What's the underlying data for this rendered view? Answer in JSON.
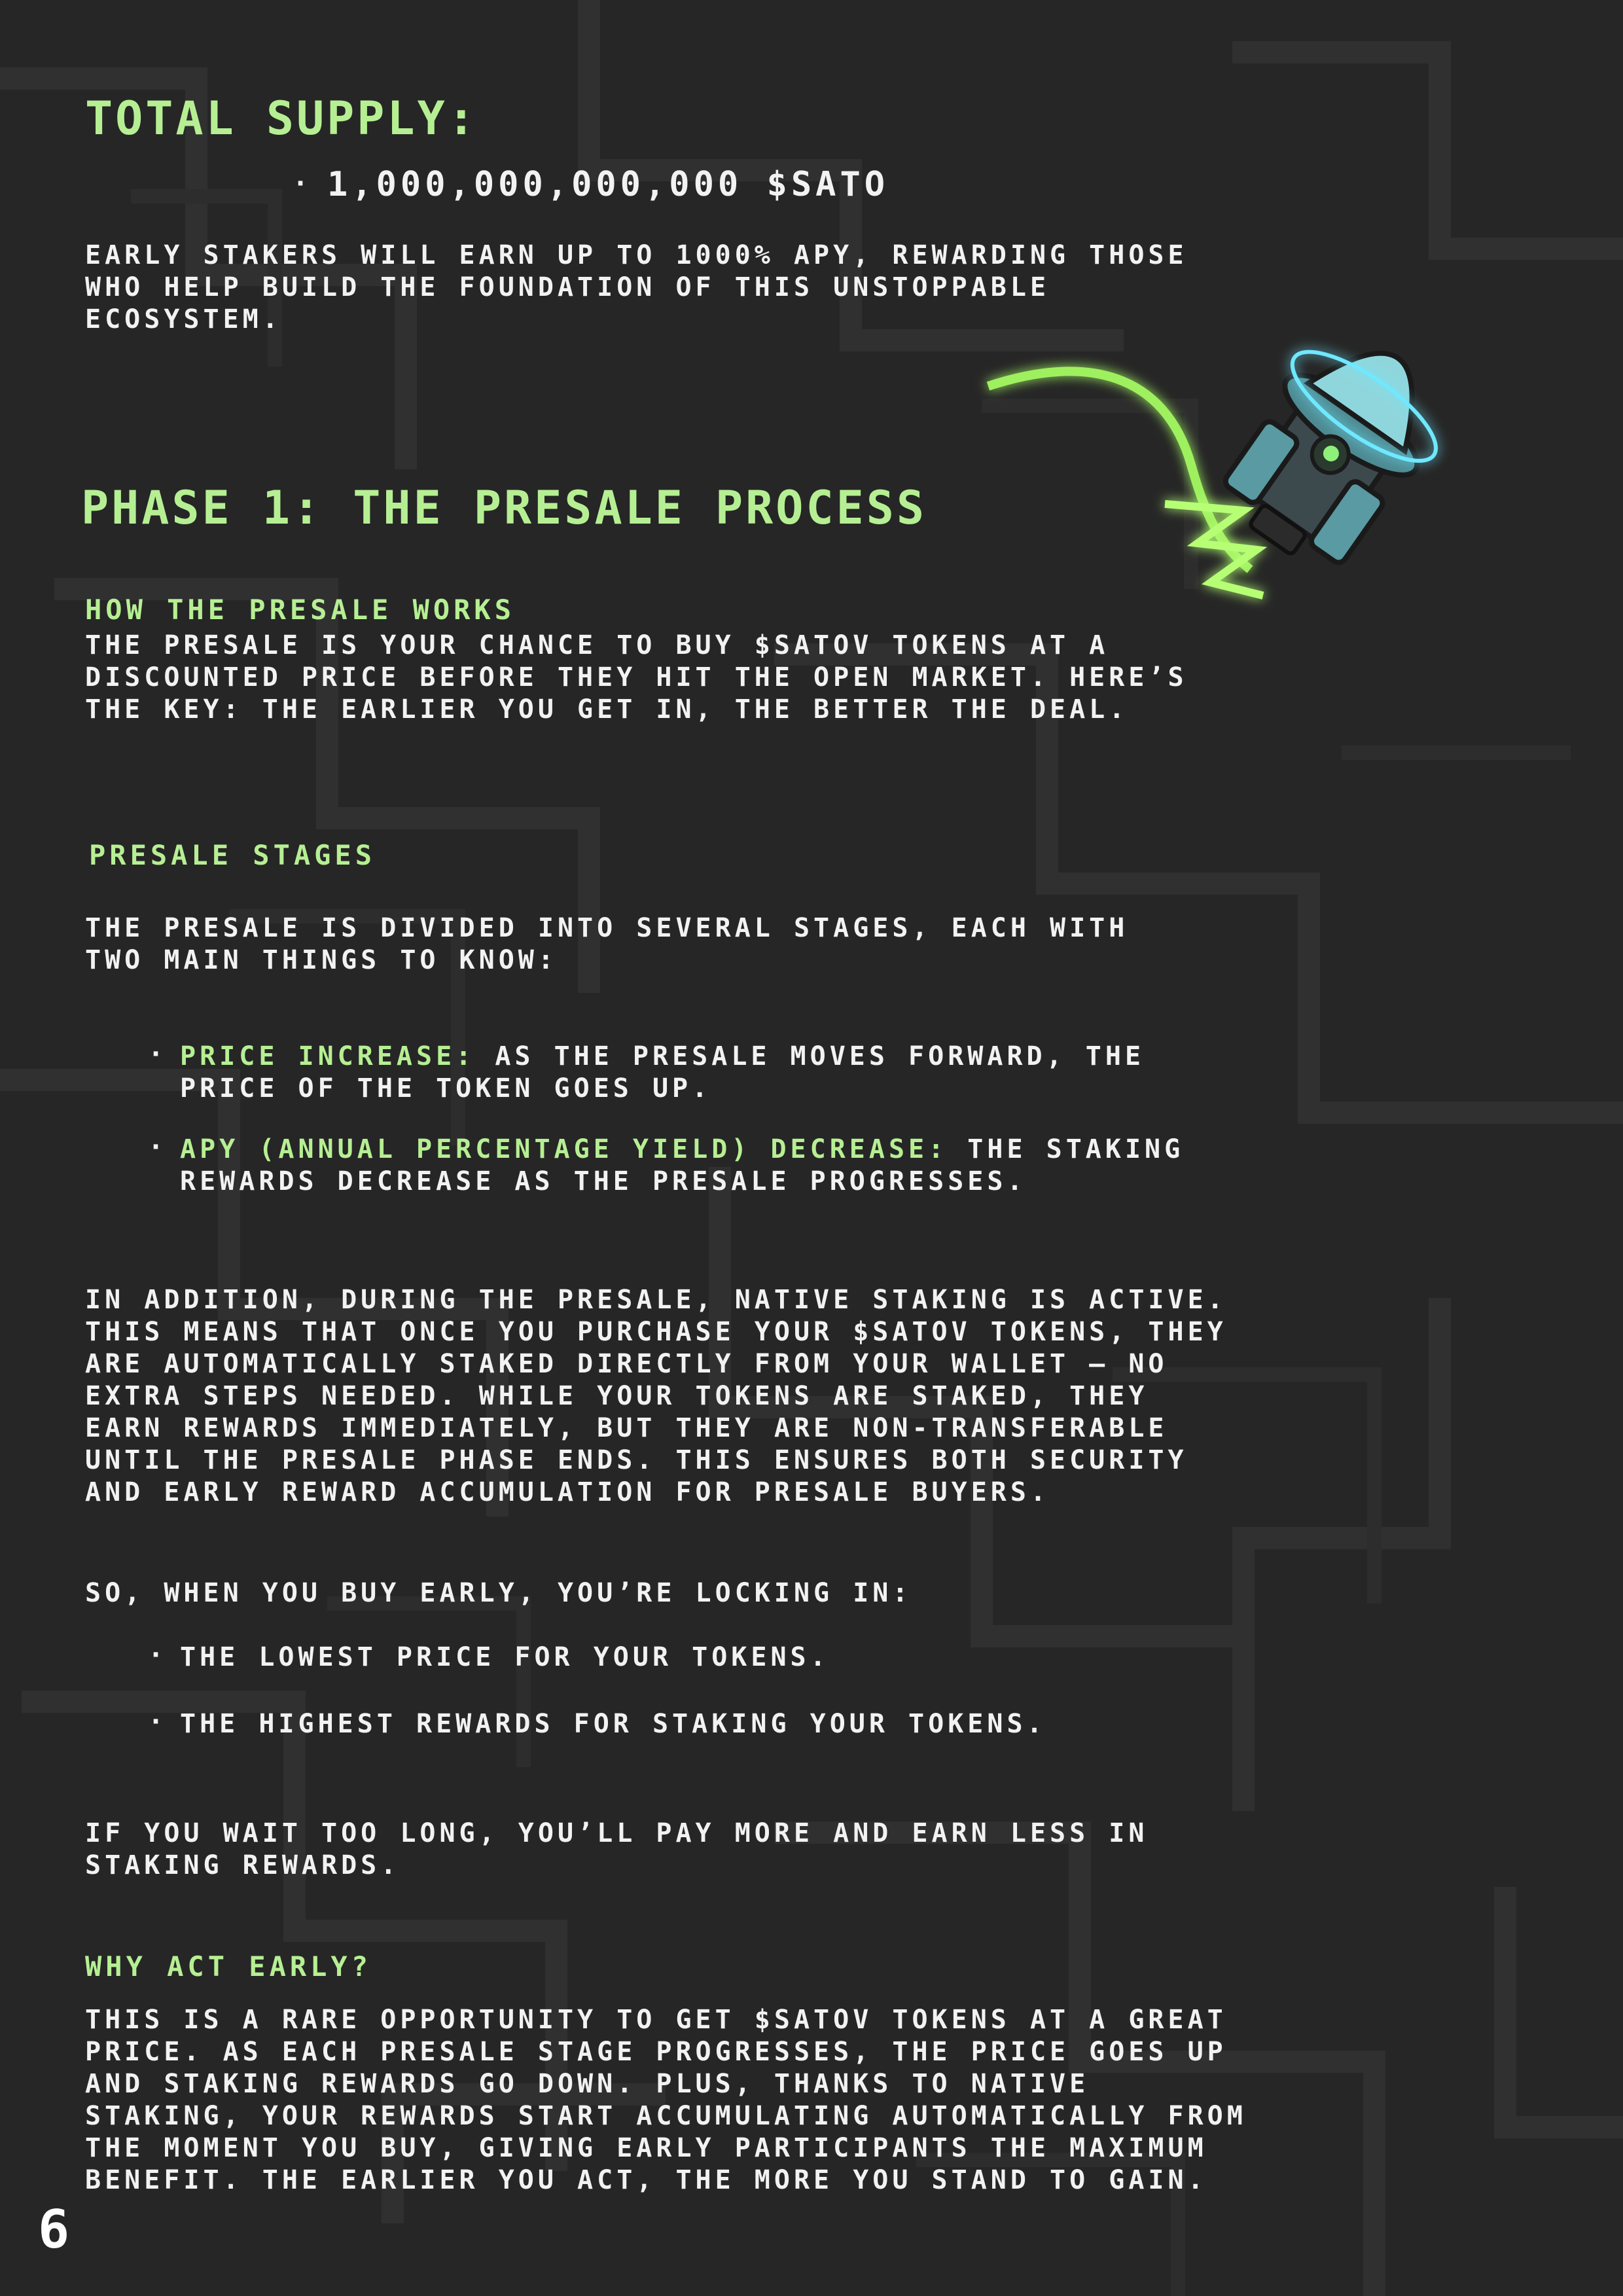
{
  "supply": {
    "heading": "TOTAL SUPPLY:",
    "value": "1,000,000,000,000 $SATO",
    "note_lines": [
      "EARLY STAKERS WILL EARN UP TO 1000% APY, REWARDING THOSE",
      "WHO HELP BUILD THE FOUNDATION OF THIS UNSTOPPABLE",
      "ECOSYSTEM."
    ]
  },
  "phase": {
    "title": "PHASE 1: THE PRESALE PROCESS",
    "how": {
      "heading": "HOW THE PRESALE WORKS",
      "lines": [
        "THE PRESALE IS YOUR CHANCE TO BUY $SATOV TOKENS AT A",
        "DISCOUNTED PRICE BEFORE THEY HIT THE OPEN MARKET. HERE’S",
        "THE KEY: THE EARLIER YOU GET IN, THE BETTER THE DEAL."
      ]
    },
    "stages": {
      "heading": "PRESALE STAGES",
      "intro_lines": [
        "THE PRESALE IS DIVIDED INTO SEVERAL STAGES, EACH WITH",
        "TWO MAIN THINGS TO KNOW:"
      ],
      "bullets": [
        {
          "label": "PRICE INCREASE:",
          "text_first": "AS THE PRESALE MOVES FORWARD, THE",
          "text_second": "PRICE OF THE TOKEN GOES UP."
        },
        {
          "label": "APY (ANNUAL PERCENTAGE YIELD) DECREASE:",
          "text_first": "THE STAKING",
          "text_second": "REWARDS DECREASE AS THE PRESALE PROGRESSES."
        }
      ]
    },
    "addition_lines": [
      "IN ADDITION, DURING THE PRESALE, NATIVE STAKING IS ACTIVE.",
      "THIS MEANS THAT ONCE YOU PURCHASE YOUR $SATOV TOKENS, THEY",
      "ARE AUTOMATICALLY STAKED DIRECTLY FROM YOUR WALLET — NO",
      "EXTRA STEPS NEEDED. WHILE YOUR TOKENS ARE STAKED, THEY",
      "EARN REWARDS IMMEDIATELY, BUT THEY ARE NON-TRANSFERABLE",
      "UNTIL THE PRESALE PHASE ENDS. THIS ENSURES BOTH SECURITY",
      "AND EARLY REWARD ACCUMULATION FOR PRESALE BUYERS."
    ],
    "locking": {
      "intro": "SO, WHEN YOU BUY EARLY, YOU’RE LOCKING IN:",
      "bullets": [
        "THE LOWEST PRICE FOR YOUR TOKENS.",
        "THE HIGHEST REWARDS FOR STAKING YOUR TOKENS."
      ]
    },
    "wait_lines": [
      "IF YOU WAIT TOO LONG, YOU’LL PAY MORE AND EARN LESS IN",
      "STAKING REWARDS."
    ],
    "why": {
      "heading": "WHY ACT EARLY?",
      "lines": [
        "THIS IS A RARE OPPORTUNITY TO GET $SATOV TOKENS AT A GREAT",
        "PRICE. AS EACH PRESALE STAGE PROGRESSES, THE PRICE GOES UP",
        "AND STAKING REWARDS GO DOWN. PLUS, THANKS TO NATIVE",
        "STAKING, YOUR REWARDS START ACCUMULATING AUTOMATICALLY FROM",
        "THE MOMENT YOU BUY, GIVING EARLY PARTICIPANTS THE MAXIMUM",
        "BENEFIT. THE EARLIER YOU ACT, THE MORE YOU STAND TO GAIN."
      ]
    }
  },
  "page_number": "6",
  "colors": {
    "background": "#262626",
    "accent_green": "#b6ef93",
    "text": "#f2f2f2",
    "rocket_teal": "#4d8a92"
  },
  "icons": {
    "background": "circuit-pattern-icon",
    "illustration": "rocket-icon"
  }
}
